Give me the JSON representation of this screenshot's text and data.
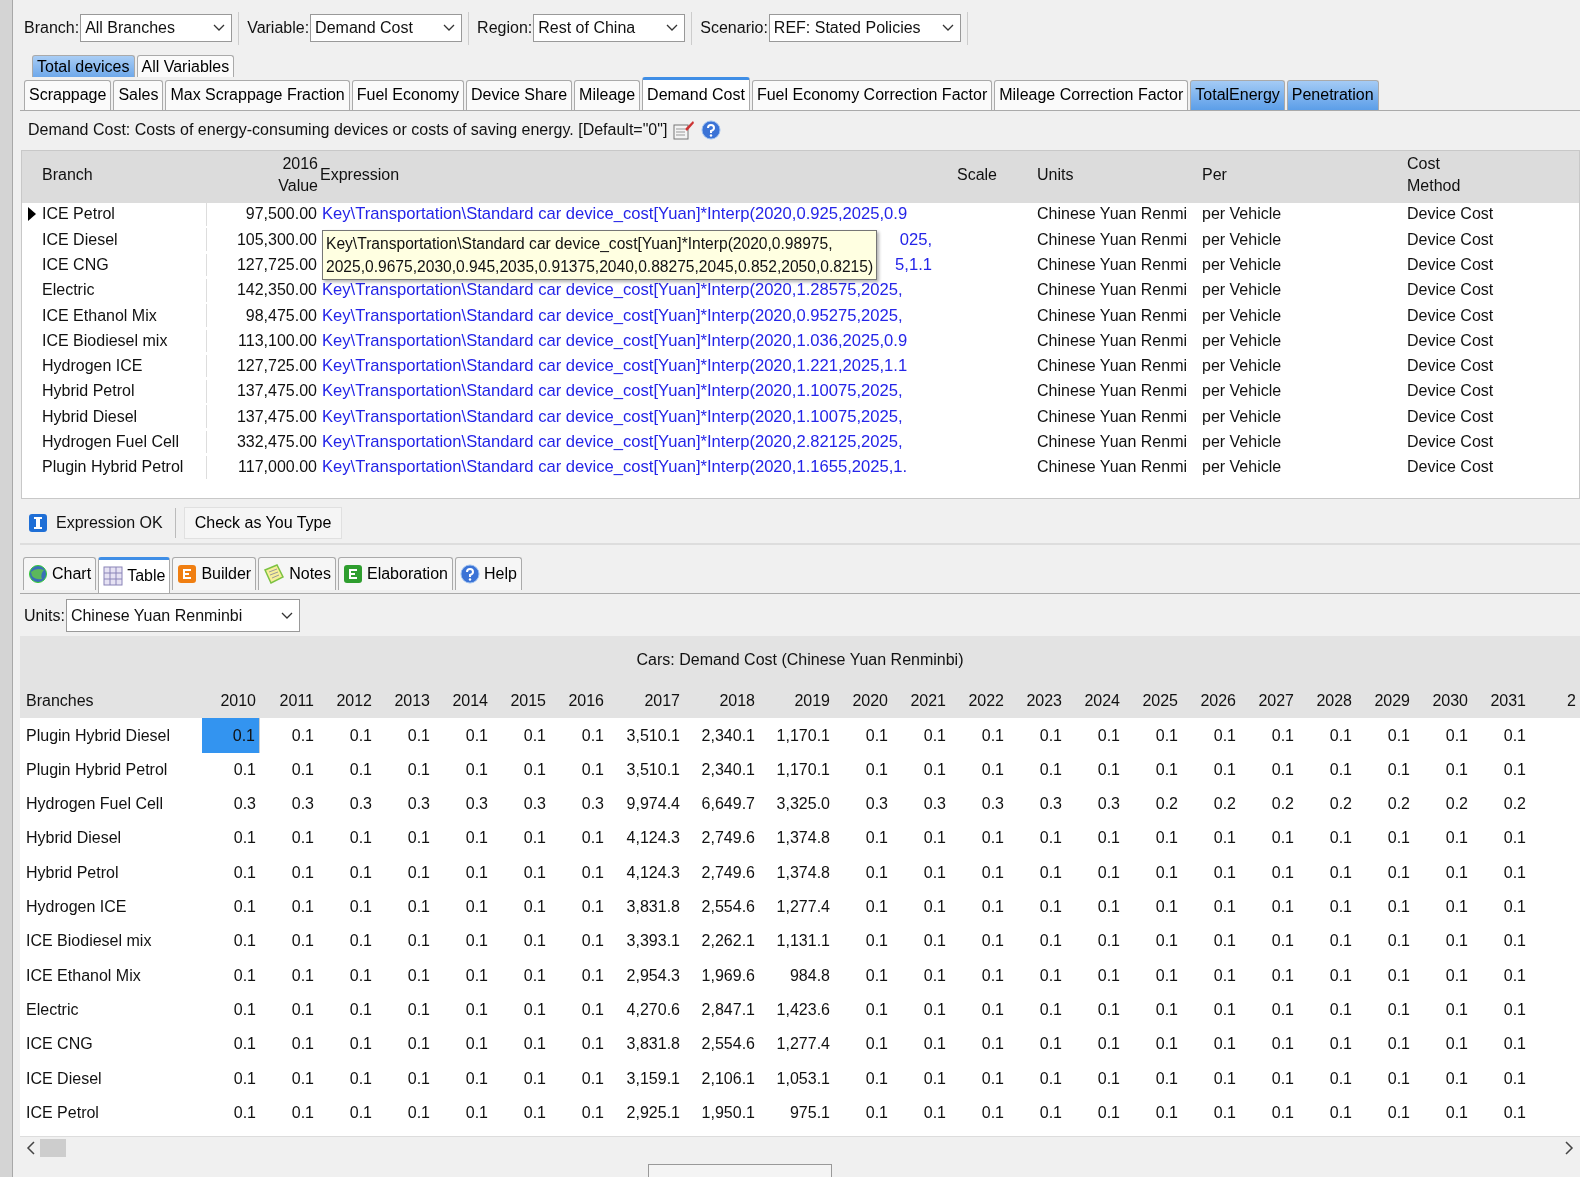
{
  "selectors": [
    {
      "label": "Branch:",
      "value": "All Branches"
    },
    {
      "label": "Variable:",
      "value": "Demand Cost"
    },
    {
      "label": "Region:",
      "value": "Rest of China"
    },
    {
      "label": "Scenario:",
      "value": "REF: Stated Policies"
    }
  ],
  "group_tabs": [
    {
      "label": "Total devices",
      "selected": true
    },
    {
      "label": "All Variables",
      "selected": false
    }
  ],
  "variable_tabs": [
    {
      "label": "Scrappage",
      "selected": false,
      "highlighted": false
    },
    {
      "label": "Sales",
      "selected": false,
      "highlighted": false
    },
    {
      "label": "Max Scrappage Fraction",
      "selected": false,
      "highlighted": false
    },
    {
      "label": "Fuel Economy",
      "selected": false,
      "highlighted": false
    },
    {
      "label": "Device Share",
      "selected": false,
      "highlighted": false
    },
    {
      "label": "Mileage",
      "selected": false,
      "highlighted": false
    },
    {
      "label": "Demand Cost",
      "selected": true,
      "highlighted": false
    },
    {
      "label": "Fuel Economy Correction Factor",
      "selected": false,
      "highlighted": false
    },
    {
      "label": "Mileage Correction Factor",
      "selected": false,
      "highlighted": false
    },
    {
      "label": "TotalEnergy",
      "selected": false,
      "highlighted": true
    },
    {
      "label": "Penetration",
      "selected": false,
      "highlighted": true
    }
  ],
  "description": "Demand Cost: Costs of energy-consuming devices or costs of saving energy. [Default=\"0\"]",
  "expression_table": {
    "columns": [
      {
        "lines": [
          "Branch"
        ]
      },
      {
        "lines": [
          "2016",
          "Value"
        ]
      },
      {
        "lines": [
          "Expression"
        ]
      },
      {
        "lines": [
          "Scale"
        ]
      },
      {
        "lines": [
          "Units"
        ]
      },
      {
        "lines": [
          "Per"
        ]
      },
      {
        "lines": [
          "Cost",
          "Method"
        ]
      }
    ],
    "rows": [
      {
        "selected": true,
        "branch": "ICE Petrol",
        "value": "97,500.00",
        "expression": "Key\\Transportation\\Standard car device_cost[Yuan]*Interp(2020,0.925,2025,0.9",
        "covered": false,
        "units": "Chinese Yuan Renmi",
        "per": "per Vehicle",
        "cost_method": "Device Cost"
      },
      {
        "selected": false,
        "branch": "ICE Diesel",
        "value": "105,300.00",
        "expression": "025,",
        "covered": true,
        "units": "Chinese Yuan Renmi",
        "per": "per Vehicle",
        "cost_method": "Device Cost"
      },
      {
        "selected": false,
        "branch": "ICE CNG",
        "value": "127,725.00",
        "expression": "5,1.1",
        "covered": true,
        "units": "Chinese Yuan Renmi",
        "per": "per Vehicle",
        "cost_method": "Device Cost"
      },
      {
        "selected": false,
        "branch": "Electric",
        "value": "142,350.00",
        "expression": "Key\\Transportation\\Standard car device_cost[Yuan]*Interp(2020,1.28575,2025,",
        "covered": false,
        "units": "Chinese Yuan Renmi",
        "per": "per Vehicle",
        "cost_method": "Device Cost"
      },
      {
        "selected": false,
        "branch": "ICE Ethanol Mix",
        "value": "98,475.00",
        "expression": "Key\\Transportation\\Standard car device_cost[Yuan]*Interp(2020,0.95275,2025,",
        "covered": false,
        "units": "Chinese Yuan Renmi",
        "per": "per Vehicle",
        "cost_method": "Device Cost"
      },
      {
        "selected": false,
        "branch": "ICE Biodiesel mix",
        "value": "113,100.00",
        "expression": "Key\\Transportation\\Standard car device_cost[Yuan]*Interp(2020,1.036,2025,0.9",
        "covered": false,
        "units": "Chinese Yuan Renmi",
        "per": "per Vehicle",
        "cost_method": "Device Cost"
      },
      {
        "selected": false,
        "branch": "Hydrogen ICE",
        "value": "127,725.00",
        "expression": "Key\\Transportation\\Standard car device_cost[Yuan]*Interp(2020,1.221,2025,1.1",
        "covered": false,
        "units": "Chinese Yuan Renmi",
        "per": "per Vehicle",
        "cost_method": "Device Cost"
      },
      {
        "selected": false,
        "branch": "Hybrid Petrol",
        "value": "137,475.00",
        "expression": "Key\\Transportation\\Standard car device_cost[Yuan]*Interp(2020,1.10075,2025,",
        "covered": false,
        "units": "Chinese Yuan Renmi",
        "per": "per Vehicle",
        "cost_method": "Device Cost"
      },
      {
        "selected": false,
        "branch": "Hybrid Diesel",
        "value": "137,475.00",
        "expression": "Key\\Transportation\\Standard car device_cost[Yuan]*Interp(2020,1.10075,2025,",
        "covered": false,
        "units": "Chinese Yuan Renmi",
        "per": "per Vehicle",
        "cost_method": "Device Cost"
      },
      {
        "selected": false,
        "branch": "Hydrogen Fuel Cell",
        "value": "332,475.00",
        "expression": "Key\\Transportation\\Standard car device_cost[Yuan]*Interp(2020,2.82125,2025,",
        "covered": false,
        "units": "Chinese Yuan Renmi",
        "per": "per Vehicle",
        "cost_method": "Device Cost"
      },
      {
        "selected": false,
        "branch": "Plugin Hybrid Petrol",
        "value": "117,000.00",
        "expression": "Key\\Transportation\\Standard car device_cost[Yuan]*Interp(2020,1.1655,2025,1.",
        "covered": false,
        "units": "Chinese Yuan Renmi",
        "per": "per Vehicle",
        "cost_method": "Device Cost"
      }
    ]
  },
  "tooltip": {
    "lines": [
      "Key\\Transportation\\Standard car device_cost[Yuan]*Interp(2020,0.98975,",
      "2025,0.9675,2030,0.945,2035,0.91375,2040,0.88275,2045,0.852,2050,0.8215)"
    ]
  },
  "status": {
    "message": "Expression OK",
    "check_button": "Check as You Type"
  },
  "view_tabs": [
    {
      "kind": "chart",
      "label": "Chart",
      "selected": false
    },
    {
      "kind": "table",
      "label": "Table",
      "selected": true
    },
    {
      "kind": "builder",
      "label": "Builder",
      "selected": false
    },
    {
      "kind": "notes",
      "label": "Notes",
      "selected": false
    },
    {
      "kind": "elaboration",
      "label": "Elaboration",
      "selected": false
    },
    {
      "kind": "help",
      "label": "Help",
      "selected": false
    }
  ],
  "units": {
    "label": "Units:",
    "value": "Chinese Yuan Renminbi"
  },
  "results": {
    "title": "Cars: Demand Cost (Chinese Yuan Renminbi)",
    "columns": [
      "Branches",
      "2010",
      "2011",
      "2012",
      "2013",
      "2014",
      "2015",
      "2016",
      "2017",
      "2018",
      "2019",
      "2020",
      "2021",
      "2022",
      "2023",
      "2024",
      "2025",
      "2026",
      "2027",
      "2028",
      "2029",
      "2030",
      "2031",
      "2"
    ],
    "rows": [
      {
        "branch": "Plugin Hybrid Diesel",
        "values": [
          "0.1",
          "0.1",
          "0.1",
          "0.1",
          "0.1",
          "0.1",
          "0.1",
          "3,510.1",
          "2,340.1",
          "1,170.1",
          "0.1",
          "0.1",
          "0.1",
          "0.1",
          "0.1",
          "0.1",
          "0.1",
          "0.1",
          "0.1",
          "0.1",
          "0.1",
          "0.1"
        ],
        "selected": [
          true,
          false,
          false,
          false,
          false,
          false,
          false,
          false,
          false,
          false,
          false,
          false,
          false,
          false,
          false,
          false,
          false,
          false,
          false,
          false,
          false,
          false
        ]
      },
      {
        "branch": "Plugin Hybrid Petrol",
        "values": [
          "0.1",
          "0.1",
          "0.1",
          "0.1",
          "0.1",
          "0.1",
          "0.1",
          "3,510.1",
          "2,340.1",
          "1,170.1",
          "0.1",
          "0.1",
          "0.1",
          "0.1",
          "0.1",
          "0.1",
          "0.1",
          "0.1",
          "0.1",
          "0.1",
          "0.1",
          "0.1"
        ],
        "selected": [
          false,
          false,
          false,
          false,
          false,
          false,
          false,
          false,
          false,
          false,
          false,
          false,
          false,
          false,
          false,
          false,
          false,
          false,
          false,
          false,
          false,
          false
        ]
      },
      {
        "branch": "Hydrogen Fuel Cell",
        "values": [
          "0.3",
          "0.3",
          "0.3",
          "0.3",
          "0.3",
          "0.3",
          "0.3",
          "9,974.4",
          "6,649.7",
          "3,325.0",
          "0.3",
          "0.3",
          "0.3",
          "0.3",
          "0.3",
          "0.2",
          "0.2",
          "0.2",
          "0.2",
          "0.2",
          "0.2",
          "0.2"
        ],
        "selected": [
          false,
          false,
          false,
          false,
          false,
          false,
          false,
          false,
          false,
          false,
          false,
          false,
          false,
          false,
          false,
          false,
          false,
          false,
          false,
          false,
          false,
          false
        ]
      },
      {
        "branch": "Hybrid Diesel",
        "values": [
          "0.1",
          "0.1",
          "0.1",
          "0.1",
          "0.1",
          "0.1",
          "0.1",
          "4,124.3",
          "2,749.6",
          "1,374.8",
          "0.1",
          "0.1",
          "0.1",
          "0.1",
          "0.1",
          "0.1",
          "0.1",
          "0.1",
          "0.1",
          "0.1",
          "0.1",
          "0.1"
        ],
        "selected": [
          false,
          false,
          false,
          false,
          false,
          false,
          false,
          false,
          false,
          false,
          false,
          false,
          false,
          false,
          false,
          false,
          false,
          false,
          false,
          false,
          false,
          false
        ]
      },
      {
        "branch": "Hybrid Petrol",
        "values": [
          "0.1",
          "0.1",
          "0.1",
          "0.1",
          "0.1",
          "0.1",
          "0.1",
          "4,124.3",
          "2,749.6",
          "1,374.8",
          "0.1",
          "0.1",
          "0.1",
          "0.1",
          "0.1",
          "0.1",
          "0.1",
          "0.1",
          "0.1",
          "0.1",
          "0.1",
          "0.1"
        ],
        "selected": [
          false,
          false,
          false,
          false,
          false,
          false,
          false,
          false,
          false,
          false,
          false,
          false,
          false,
          false,
          false,
          false,
          false,
          false,
          false,
          false,
          false,
          false
        ]
      },
      {
        "branch": "Hydrogen ICE",
        "values": [
          "0.1",
          "0.1",
          "0.1",
          "0.1",
          "0.1",
          "0.1",
          "0.1",
          "3,831.8",
          "2,554.6",
          "1,277.4",
          "0.1",
          "0.1",
          "0.1",
          "0.1",
          "0.1",
          "0.1",
          "0.1",
          "0.1",
          "0.1",
          "0.1",
          "0.1",
          "0.1"
        ],
        "selected": [
          false,
          false,
          false,
          false,
          false,
          false,
          false,
          false,
          false,
          false,
          false,
          false,
          false,
          false,
          false,
          false,
          false,
          false,
          false,
          false,
          false,
          false
        ]
      },
      {
        "branch": "ICE Biodiesel mix",
        "values": [
          "0.1",
          "0.1",
          "0.1",
          "0.1",
          "0.1",
          "0.1",
          "0.1",
          "3,393.1",
          "2,262.1",
          "1,131.1",
          "0.1",
          "0.1",
          "0.1",
          "0.1",
          "0.1",
          "0.1",
          "0.1",
          "0.1",
          "0.1",
          "0.1",
          "0.1",
          "0.1"
        ],
        "selected": [
          false,
          false,
          false,
          false,
          false,
          false,
          false,
          false,
          false,
          false,
          false,
          false,
          false,
          false,
          false,
          false,
          false,
          false,
          false,
          false,
          false,
          false
        ]
      },
      {
        "branch": "ICE Ethanol Mix",
        "values": [
          "0.1",
          "0.1",
          "0.1",
          "0.1",
          "0.1",
          "0.1",
          "0.1",
          "2,954.3",
          "1,969.6",
          "984.8",
          "0.1",
          "0.1",
          "0.1",
          "0.1",
          "0.1",
          "0.1",
          "0.1",
          "0.1",
          "0.1",
          "0.1",
          "0.1",
          "0.1"
        ],
        "selected": [
          false,
          false,
          false,
          false,
          false,
          false,
          false,
          false,
          false,
          false,
          false,
          false,
          false,
          false,
          false,
          false,
          false,
          false,
          false,
          false,
          false,
          false
        ]
      },
      {
        "branch": "Electric",
        "values": [
          "0.1",
          "0.1",
          "0.1",
          "0.1",
          "0.1",
          "0.1",
          "0.1",
          "4,270.6",
          "2,847.1",
          "1,423.6",
          "0.1",
          "0.1",
          "0.1",
          "0.1",
          "0.1",
          "0.1",
          "0.1",
          "0.1",
          "0.1",
          "0.1",
          "0.1",
          "0.1"
        ],
        "selected": [
          false,
          false,
          false,
          false,
          false,
          false,
          false,
          false,
          false,
          false,
          false,
          false,
          false,
          false,
          false,
          false,
          false,
          false,
          false,
          false,
          false,
          false
        ]
      },
      {
        "branch": "ICE CNG",
        "values": [
          "0.1",
          "0.1",
          "0.1",
          "0.1",
          "0.1",
          "0.1",
          "0.1",
          "3,831.8",
          "2,554.6",
          "1,277.4",
          "0.1",
          "0.1",
          "0.1",
          "0.1",
          "0.1",
          "0.1",
          "0.1",
          "0.1",
          "0.1",
          "0.1",
          "0.1",
          "0.1"
        ],
        "selected": [
          false,
          false,
          false,
          false,
          false,
          false,
          false,
          false,
          false,
          false,
          false,
          false,
          false,
          false,
          false,
          false,
          false,
          false,
          false,
          false,
          false,
          false
        ]
      },
      {
        "branch": "ICE Diesel",
        "values": [
          "0.1",
          "0.1",
          "0.1",
          "0.1",
          "0.1",
          "0.1",
          "0.1",
          "3,159.1",
          "2,106.1",
          "1,053.1",
          "0.1",
          "0.1",
          "0.1",
          "0.1",
          "0.1",
          "0.1",
          "0.1",
          "0.1",
          "0.1",
          "0.1",
          "0.1",
          "0.1"
        ],
        "selected": [
          false,
          false,
          false,
          false,
          false,
          false,
          false,
          false,
          false,
          false,
          false,
          false,
          false,
          false,
          false,
          false,
          false,
          false,
          false,
          false,
          false,
          false
        ]
      },
      {
        "branch": "ICE Petrol",
        "values": [
          "0.1",
          "0.1",
          "0.1",
          "0.1",
          "0.1",
          "0.1",
          "0.1",
          "2,925.1",
          "1,950.1",
          "975.1",
          "0.1",
          "0.1",
          "0.1",
          "0.1",
          "0.1",
          "0.1",
          "0.1",
          "0.1",
          "0.1",
          "0.1",
          "0.1",
          "0.1"
        ],
        "selected": [
          false,
          false,
          false,
          false,
          false,
          false,
          false,
          false,
          false,
          false,
          false,
          false,
          false,
          false,
          false,
          false,
          false,
          false,
          false,
          false,
          false,
          false
        ]
      }
    ]
  }
}
